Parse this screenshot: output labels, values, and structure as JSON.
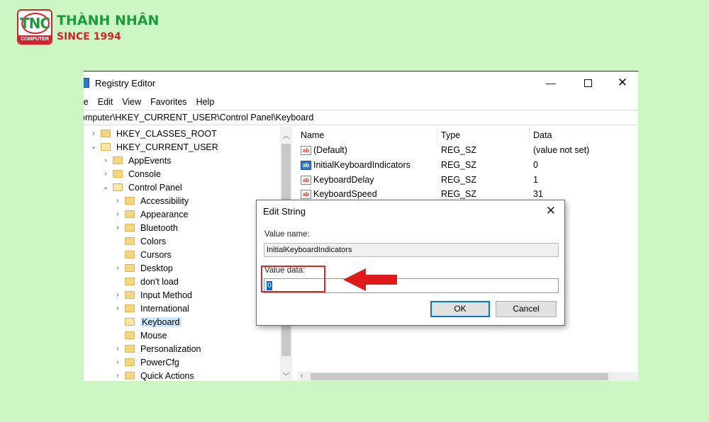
{
  "logo": {
    "badge": "TNC",
    "badge_sub": "COMPUTER",
    "name": "THÀNH NHÂN",
    "since": "SINCE 1994"
  },
  "window": {
    "title": "Registry Editor",
    "controls": {
      "minimize": "—",
      "close": "✕"
    }
  },
  "menu": [
    "le",
    "Edit",
    "View",
    "Favorites",
    "Help"
  ],
  "address": "omputer\\HKEY_CURRENT_USER\\Control Panel\\Keyboard",
  "tree": [
    {
      "label": "HKEY_CLASSES_ROOT",
      "chev": "›"
    },
    {
      "label": "HKEY_CURRENT_USER",
      "chev": "⌄"
    },
    {
      "label": "AppEvents",
      "chev": "›"
    },
    {
      "label": "Console",
      "chev": "›"
    },
    {
      "label": "Control Panel",
      "chev": "⌄"
    },
    {
      "label": "Accessibility",
      "chev": "›"
    },
    {
      "label": "Appearance",
      "chev": "›"
    },
    {
      "label": "Bluetooth",
      "chev": "›"
    },
    {
      "label": "Colors",
      "chev": ""
    },
    {
      "label": "Cursors",
      "chev": ""
    },
    {
      "label": "Desktop",
      "chev": "›"
    },
    {
      "label": "don't load",
      "chev": ""
    },
    {
      "label": "Input Method",
      "chev": "›"
    },
    {
      "label": "International",
      "chev": "›"
    },
    {
      "label": "Keyboard",
      "chev": "",
      "selected": true
    },
    {
      "label": "Mouse",
      "chev": ""
    },
    {
      "label": "Personalization",
      "chev": "›"
    },
    {
      "label": "PowerCfg",
      "chev": "›"
    },
    {
      "label": "Quick Actions",
      "chev": "›"
    }
  ],
  "list": {
    "headers": {
      "name": "Name",
      "type": "Type",
      "data": "Data"
    },
    "rows": [
      {
        "name": "(Default)",
        "type": "REG_SZ",
        "data": "(value not set)",
        "icon": "ab"
      },
      {
        "name": "InitialKeyboardIndicators",
        "type": "REG_SZ",
        "data": "0",
        "icon": "ab"
      },
      {
        "name": "KeyboardDelay",
        "type": "REG_SZ",
        "data": "1",
        "icon": "ab"
      },
      {
        "name": "KeyboardSpeed",
        "type": "REG_SZ",
        "data": "31",
        "icon": "ab"
      }
    ]
  },
  "dialog": {
    "title": "Edit String",
    "close": "✕",
    "value_name_label": "Value name:",
    "value_name": "InitialKeyboardIndicators",
    "value_data_label": "Value data:",
    "value_data": "0",
    "ok_label": "OK",
    "cancel_label": "Cancel"
  },
  "colors": {
    "background": "#ccf7c4",
    "highlight": "#d42a2a",
    "selection": "#cde8ff"
  }
}
